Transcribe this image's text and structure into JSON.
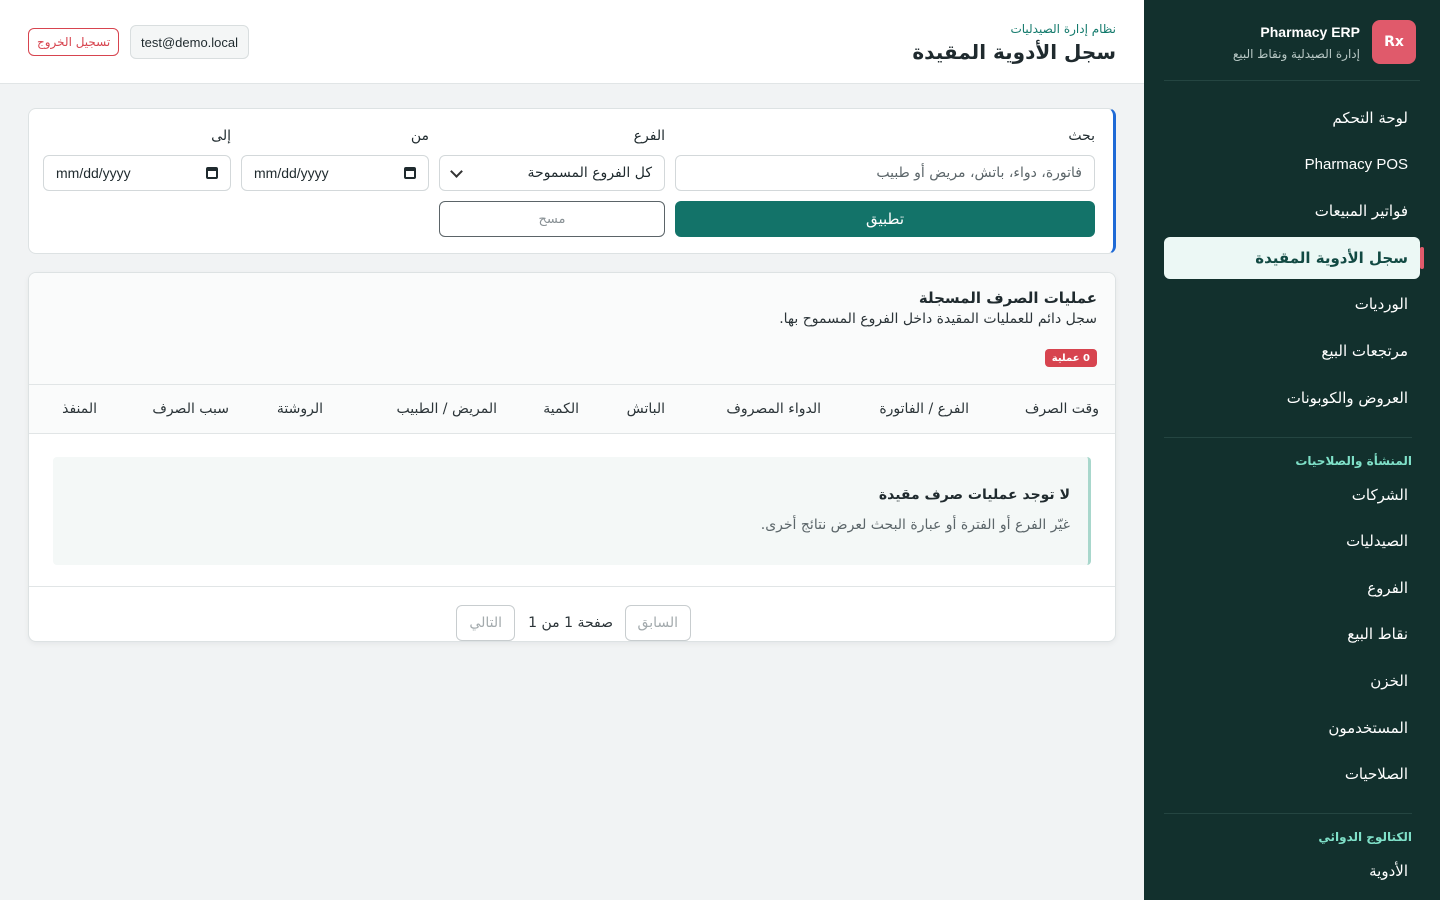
{
  "sidebar": {
    "logo": "Rx",
    "title": "Pharmacy ERP",
    "subtitle": "إدارة الصيدلية ونقاط البيع",
    "items": [
      {
        "label": "لوحة التحكم"
      },
      {
        "label": "Pharmacy POS"
      },
      {
        "label": "فواتير المبيعات"
      },
      {
        "label": "سجل الأدوية المقيدة",
        "active": true
      },
      {
        "label": "الورديات"
      },
      {
        "label": "مرتجعات البيع"
      },
      {
        "label": "العروض والكوبونات"
      }
    ],
    "section_org": {
      "title": "المنشأة والصلاحيات",
      "items": [
        {
          "label": "الشركات"
        },
        {
          "label": "الصيدليات"
        },
        {
          "label": "الفروع"
        },
        {
          "label": "نقاط البيع"
        },
        {
          "label": "الخزن"
        },
        {
          "label": "المستخدمون"
        },
        {
          "label": "الصلاحيات"
        }
      ]
    },
    "section_catalog": {
      "title": "الكتالوج الدوائي",
      "items": [
        {
          "label": "الأدوية"
        }
      ]
    }
  },
  "header": {
    "breadcrumb": "نظام إدارة الصيدليات",
    "title": "سجل الأدوية المقيدة",
    "user_email": "test@demo.local",
    "logout_label": "تسجيل الخروج"
  },
  "filters": {
    "search_label": "بحث",
    "search_placeholder": "فاتورة، دواء، باتش، مريض أو طبيب",
    "branch_label": "الفرع",
    "branch_value": "كل الفروع المسموحة",
    "from_label": "من",
    "from_value": "mm/dd/yyyy",
    "to_label": "إلى",
    "to_value": "mm/dd/yyyy",
    "apply_label": "تطبيق",
    "clear_label": "مسح"
  },
  "results": {
    "title": "عمليات الصرف المسجلة",
    "subtitle": "سجل دائم للعمليات المقيدة داخل الفروع المسموح بها.",
    "count_badge": "0 عملية",
    "columns": [
      "وقت الصرف",
      "الفرع / الفاتورة",
      "الدواء المصروف",
      "الباتش",
      "الكمية",
      "المريض / الطبيب",
      "الروشتة",
      "سبب الصرف",
      "المنفذ"
    ],
    "rows": [],
    "empty_title": "لا توجد عمليات صرف مقيدة",
    "empty_subtitle": "غيّر الفرع أو الفترة أو عبارة البحث لعرض نتائج أخرى.",
    "pagination": {
      "prev_label": "السابق",
      "page_label": "صفحة 1 من 1",
      "next_label": "التالي"
    }
  },
  "colors": {
    "sidebar_bg": "#12302d",
    "accent": "#137369",
    "danger": "#d7444f",
    "active_bg": "#ecf8f5"
  }
}
